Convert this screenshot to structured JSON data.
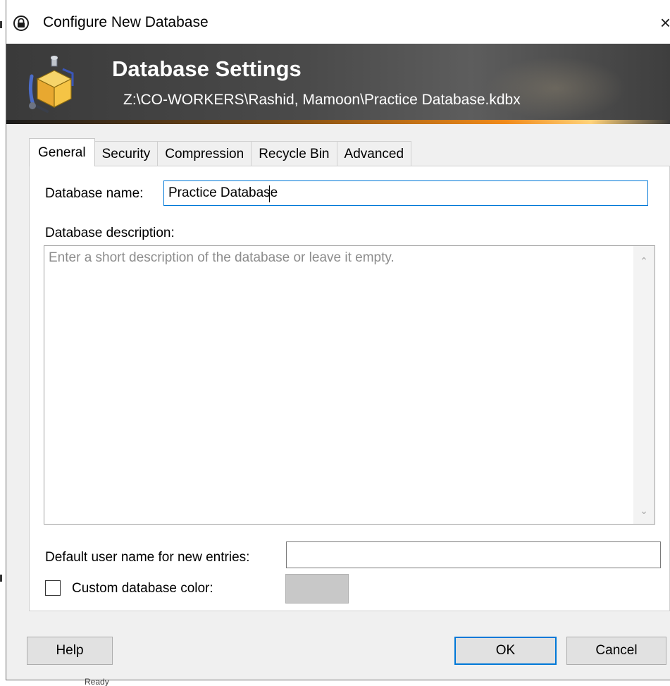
{
  "window": {
    "title": "Configure New Database",
    "close_glyph": "×"
  },
  "banner": {
    "title": "Database Settings",
    "path": "Z:\\CO-WORKERS\\Rashid, Mamoon\\Practice Database.kdbx"
  },
  "tabs": [
    {
      "label": "General",
      "active": true
    },
    {
      "label": "Security",
      "active": false
    },
    {
      "label": "Compression",
      "active": false
    },
    {
      "label": "Recycle Bin",
      "active": false
    },
    {
      "label": "Advanced",
      "active": false
    }
  ],
  "general": {
    "name_label": "Database name:",
    "name_value": "Practice Database",
    "description_label": "Database description:",
    "description_placeholder": "Enter a short description of the database or leave it empty.",
    "description_value": "",
    "default_user_label": "Default user name for new entries:",
    "default_user_value": "",
    "custom_color_label": "Custom database color:",
    "custom_color_checked": false,
    "custom_color_swatch": "#c8c8c8"
  },
  "buttons": {
    "help": "Help",
    "ok": "OK",
    "cancel": "Cancel"
  },
  "background_fragment": "Ready",
  "colors": {
    "accent": "#0078d7",
    "banner_bg": "#4a4a4a",
    "banner_line": "#f08a1a",
    "dialog_bg": "#f0f0f0"
  }
}
